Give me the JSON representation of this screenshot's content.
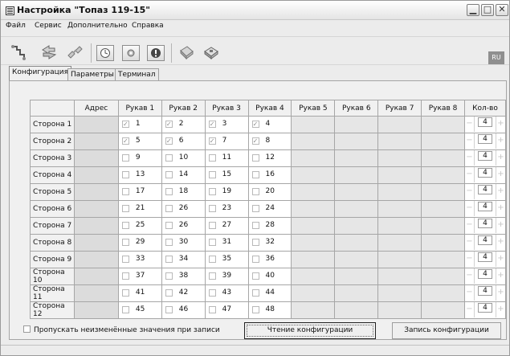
{
  "window": {
    "title": "Настройка \"Топаз 119-15\"",
    "controls": [
      "minimize",
      "maximize",
      "close"
    ]
  },
  "menu": {
    "items": [
      "Файл",
      "Сервис",
      "Дополнительно",
      "Справка"
    ]
  },
  "toolbar": {
    "buttons": [
      "connect-icon",
      "exchange-icon",
      "disconnect-icon",
      "clock-icon",
      "settings-icon",
      "info-icon",
      "device-icon",
      "database-icon"
    ],
    "language": "RU"
  },
  "tabs": [
    "Конфигурация",
    "Параметры",
    "Терминал"
  ],
  "grid": {
    "headers": [
      "",
      "Адрес",
      "Рукав 1",
      "Рукав 2",
      "Рукав 3",
      "Рукав 4",
      "Рукав 5",
      "Рукав 6",
      "Рукав 7",
      "Рукав 8",
      "Кол-во"
    ],
    "rows": [
      {
        "side": "Сторона 1",
        "checked": true,
        "nozzles": [
          "1",
          "2",
          "3",
          "4"
        ],
        "count": "4"
      },
      {
        "side": "Сторона 2",
        "checked": true,
        "nozzles": [
          "5",
          "6",
          "7",
          "8"
        ],
        "count": "4"
      },
      {
        "side": "Сторона 3",
        "checked": false,
        "nozzles": [
          "9",
          "10",
          "11",
          "12"
        ],
        "count": "4"
      },
      {
        "side": "Сторона 4",
        "checked": false,
        "nozzles": [
          "13",
          "14",
          "15",
          "16"
        ],
        "count": "4"
      },
      {
        "side": "Сторона 5",
        "checked": false,
        "nozzles": [
          "17",
          "18",
          "19",
          "20"
        ],
        "count": "4"
      },
      {
        "side": "Сторона 6",
        "checked": false,
        "nozzles": [
          "21",
          "26",
          "23",
          "24"
        ],
        "count": "4"
      },
      {
        "side": "Сторона 7",
        "checked": false,
        "nozzles": [
          "25",
          "26",
          "27",
          "28"
        ],
        "count": "4"
      },
      {
        "side": "Сторона 8",
        "checked": false,
        "nozzles": [
          "29",
          "30",
          "31",
          "32"
        ],
        "count": "4"
      },
      {
        "side": "Сторона 9",
        "checked": false,
        "nozzles": [
          "33",
          "34",
          "35",
          "36"
        ],
        "count": "4"
      },
      {
        "side": "Сторона 10",
        "checked": false,
        "nozzles": [
          "37",
          "38",
          "39",
          "40"
        ],
        "count": "4"
      },
      {
        "side": "Сторона 11",
        "checked": false,
        "nozzles": [
          "41",
          "42",
          "43",
          "44"
        ],
        "count": "4"
      },
      {
        "side": "Сторона 12",
        "checked": false,
        "nozzles": [
          "45",
          "46",
          "47",
          "48"
        ],
        "count": "4"
      }
    ]
  },
  "footer": {
    "skip_unchanged_label": "Пропускать неизменённые значения при записи",
    "read_button": "Чтение конфигурации",
    "write_button": "Запись конфигурации"
  }
}
